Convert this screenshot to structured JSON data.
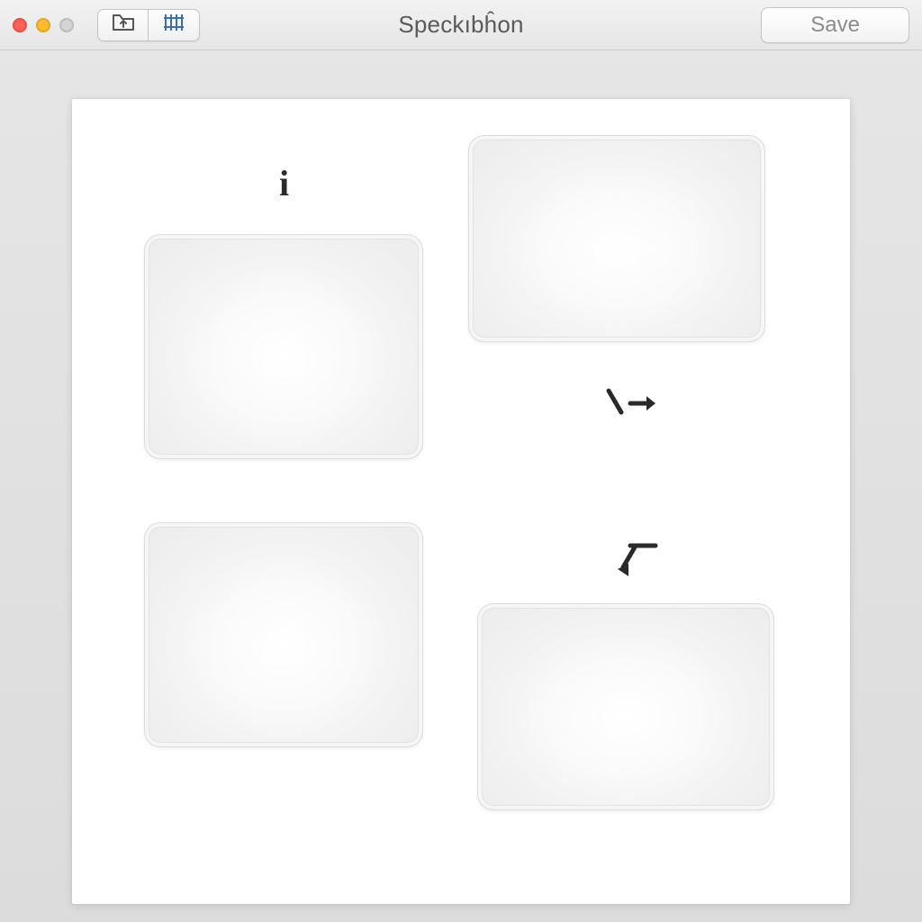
{
  "window": {
    "title": "Speckıbĥon",
    "save_label": "Save"
  },
  "toolbar": {
    "segmented": [
      {
        "id": "folder",
        "icon": "folder-up-icon"
      },
      {
        "id": "grid",
        "icon": "grid-icon"
      }
    ]
  },
  "canvas": {
    "glyphs": {
      "info": "i"
    },
    "panels": [
      {
        "id": "panel-top-left"
      },
      {
        "id": "panel-top-right"
      },
      {
        "id": "panel-bottom-left"
      },
      {
        "id": "panel-bottom-right"
      }
    ],
    "arrows": [
      {
        "id": "arrow-down-right"
      },
      {
        "id": "arrow-kink"
      }
    ]
  }
}
